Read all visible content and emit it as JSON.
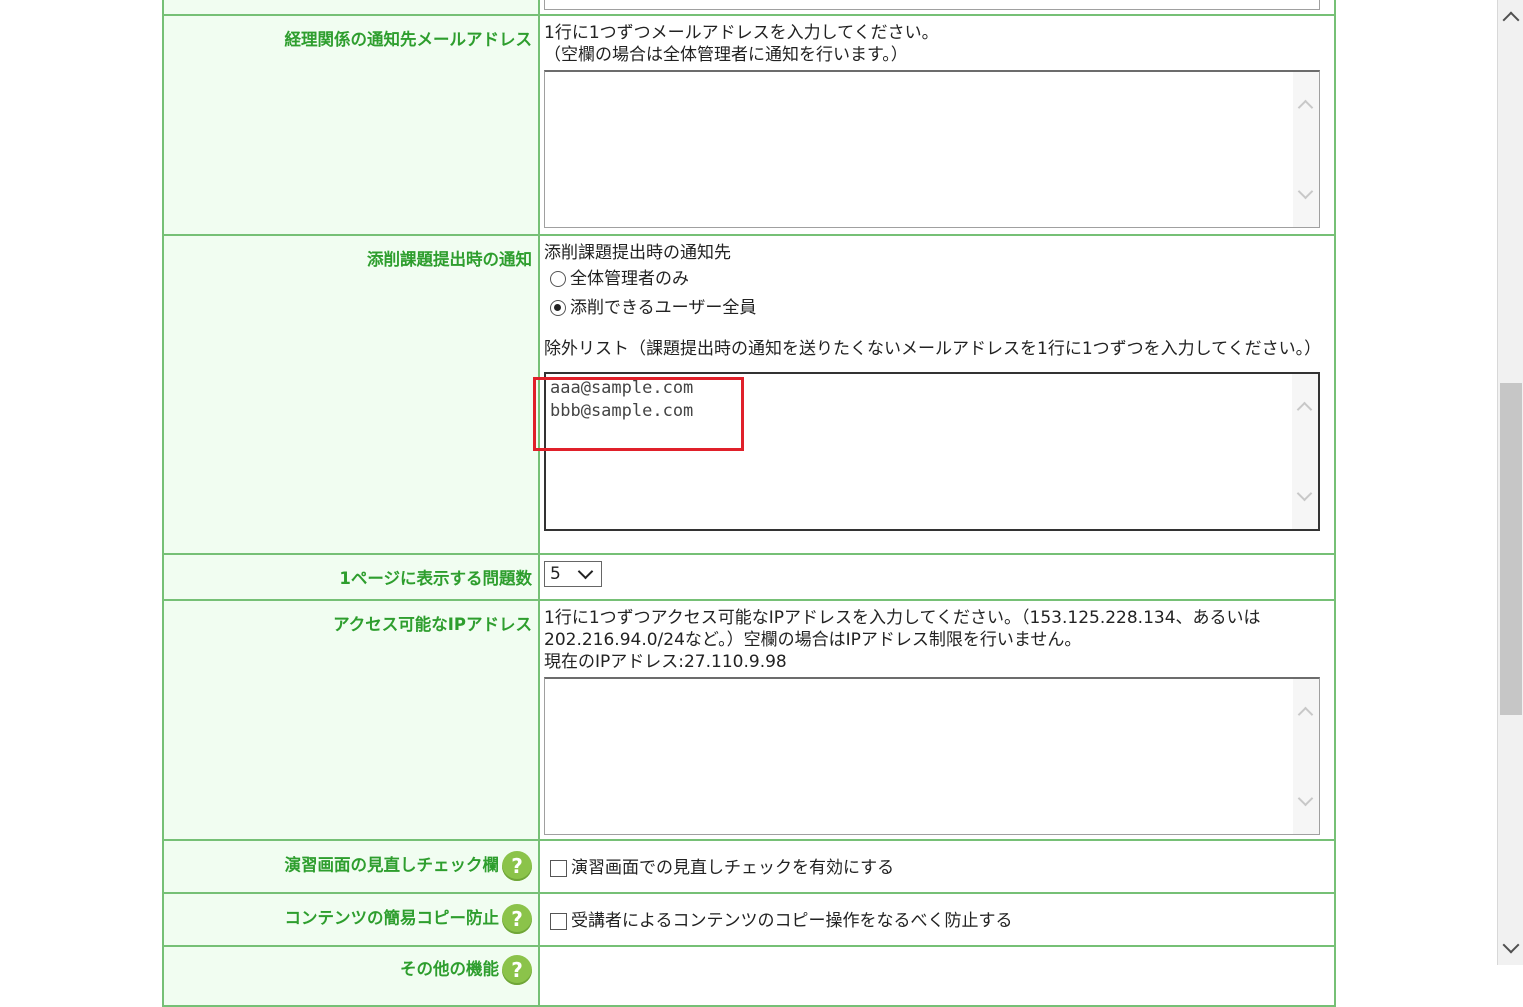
{
  "rows": {
    "finance_email": {
      "label": "経理関係の通知先メールアドレス",
      "desc1": "1行に1つずつメールアドレスを入力してください。",
      "desc2": "（空欄の場合は全体管理者に通知を行います。）",
      "value": ""
    },
    "assignment_notify": {
      "label": "添削課題提出時の通知",
      "title": "添削課題提出時の通知先",
      "options": [
        {
          "label": "全体管理者のみ",
          "checked": false
        },
        {
          "label": "添削できるユーザー全員",
          "checked": true
        }
      ],
      "exclude_label": "除外リスト（課題提出時の通知を送りたくないメールアドレスを1行に1つずつを入力してください。）",
      "exclude_lines": [
        "aaa@sample.com",
        "bbb@sample.com"
      ]
    },
    "per_page": {
      "label": "1ページに表示する問題数",
      "selected": "5"
    },
    "ip_access": {
      "label": "アクセス可能なIPアドレス",
      "desc1": "1行に1つずつアクセス可能なIPアドレスを入力してください。（153.125.228.134、あるいは",
      "desc2": "202.216.94.0/24など。）空欄の場合はIPアドレス制限を行いません。",
      "current": "現在のIPアドレス:27.110.9.98",
      "value": ""
    },
    "review_check": {
      "label": "演習画面の見直しチェック欄",
      "help": "?",
      "checkbox_label": "演習画面での見直しチェックを有効にする",
      "checked": false
    },
    "copy_protect": {
      "label": "コンテンツの簡易コピー防止",
      "help": "?",
      "checkbox_label": "受講者によるコンテンツのコピー操作をなるべく防止する",
      "checked": false
    },
    "other": {
      "label": "その他の機能",
      "help": "?"
    }
  },
  "colors": {
    "label_text": "#2e9e2e",
    "label_bg": "#f1fdf1",
    "border": "#76c076",
    "highlight": "#e0202a",
    "help_icon": "#8bc34a"
  }
}
